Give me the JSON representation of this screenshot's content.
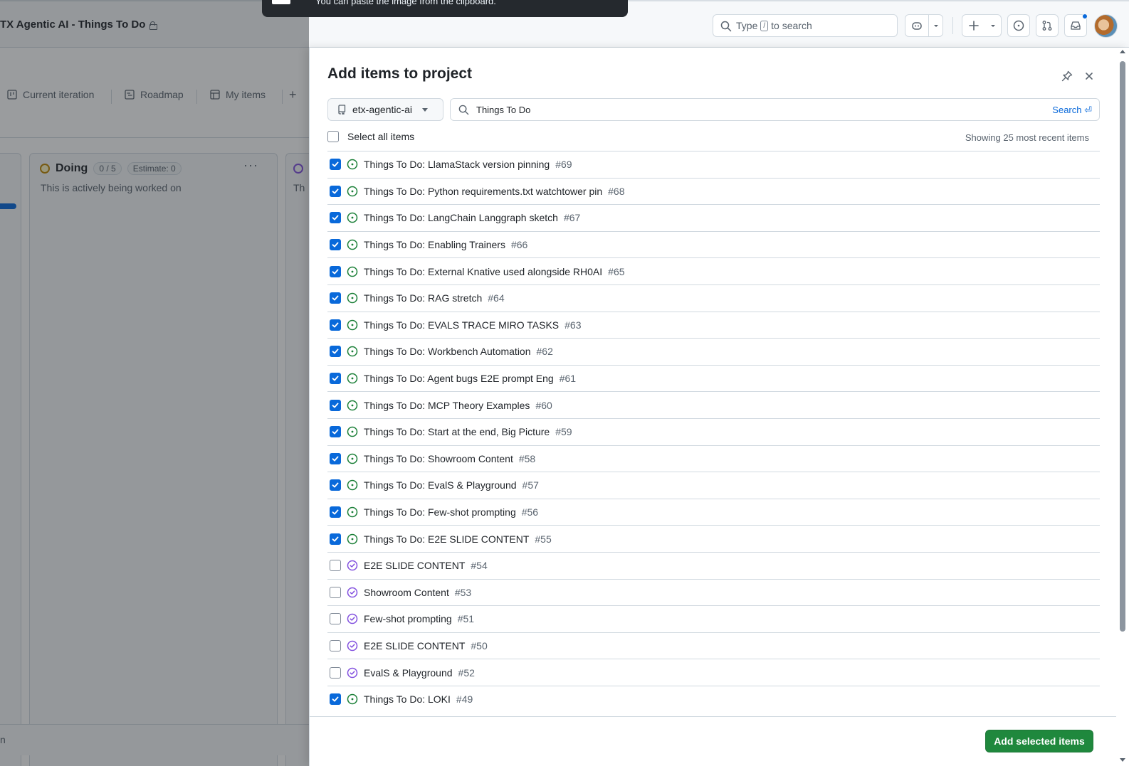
{
  "header": {
    "project_title": "TX Agentic AI - Things To Do",
    "search_placeholder_prefix": "Type",
    "search_shortcut": "/",
    "search_placeholder_suffix": "to search",
    "toast_text": "You can paste the image from the clipboard."
  },
  "board": {
    "tabs": [
      {
        "label": "Current iteration",
        "icon": "board-icon"
      },
      {
        "label": "Roadmap",
        "icon": "roadmap-icon"
      },
      {
        "label": "My items",
        "icon": "table-icon"
      }
    ],
    "add_view_label": "+",
    "column": {
      "name": "Doing",
      "count": "0 / 5",
      "estimate": "Estimate: 0",
      "description": "This is actively being worked on",
      "status_color": "#bf8700"
    },
    "next_column_snippet": "Th",
    "footer_snippet": "n"
  },
  "panel": {
    "title": "Add items to project",
    "repo": "etx-agentic-ai",
    "search_value": "Things To Do",
    "search_button": "Search ⏎",
    "select_all_label": "Select all items",
    "showing_text": "Showing 25 most recent items",
    "add_button": "Add selected items",
    "items": [
      {
        "title": "Things To Do: LlamaStack version pinning",
        "number": "#69",
        "checked": true,
        "state": "open"
      },
      {
        "title": "Things To Do: Python requirements.txt watchtower pin",
        "number": "#68",
        "checked": true,
        "state": "open"
      },
      {
        "title": "Things To Do: LangChain Langgraph sketch",
        "number": "#67",
        "checked": true,
        "state": "open"
      },
      {
        "title": "Things To Do: Enabling Trainers",
        "number": "#66",
        "checked": true,
        "state": "open"
      },
      {
        "title": "Things To Do: External Knative used alongside RH0AI",
        "number": "#65",
        "checked": true,
        "state": "open"
      },
      {
        "title": "Things To Do: RAG stretch",
        "number": "#64",
        "checked": true,
        "state": "open"
      },
      {
        "title": "Things To Do: EVALS TRACE MIRO TASKS",
        "number": "#63",
        "checked": true,
        "state": "open"
      },
      {
        "title": "Things To Do: Workbench Automation",
        "number": "#62",
        "checked": true,
        "state": "open"
      },
      {
        "title": "Things To Do: Agent bugs E2E prompt Eng",
        "number": "#61",
        "checked": true,
        "state": "open"
      },
      {
        "title": "Things To Do: MCP Theory Examples",
        "number": "#60",
        "checked": true,
        "state": "open"
      },
      {
        "title": "Things To Do: Start at the end, Big Picture",
        "number": "#59",
        "checked": true,
        "state": "open"
      },
      {
        "title": "Things To Do: Showroom Content",
        "number": "#58",
        "checked": true,
        "state": "open"
      },
      {
        "title": "Things To Do: EvalS & Playground",
        "number": "#57",
        "checked": true,
        "state": "open"
      },
      {
        "title": "Things To Do: Few-shot prompting",
        "number": "#56",
        "checked": true,
        "state": "open"
      },
      {
        "title": "Things To Do: E2E SLIDE CONTENT",
        "number": "#55",
        "checked": true,
        "state": "open"
      },
      {
        "title": "E2E SLIDE CONTENT",
        "number": "#54",
        "checked": false,
        "state": "closed"
      },
      {
        "title": "Showroom Content",
        "number": "#53",
        "checked": false,
        "state": "closed"
      },
      {
        "title": "Few-shot prompting",
        "number": "#51",
        "checked": false,
        "state": "closed"
      },
      {
        "title": "E2E SLIDE CONTENT",
        "number": "#50",
        "checked": false,
        "state": "closed"
      },
      {
        "title": "EvalS & Playground",
        "number": "#52",
        "checked": false,
        "state": "closed"
      },
      {
        "title": "Things To Do: LOKI",
        "number": "#49",
        "checked": true,
        "state": "open"
      }
    ]
  },
  "colors": {
    "open_issue": "#1a7f37",
    "closed_issue": "#8250df",
    "accent": "#0969da",
    "primary_button": "#1f883d"
  }
}
